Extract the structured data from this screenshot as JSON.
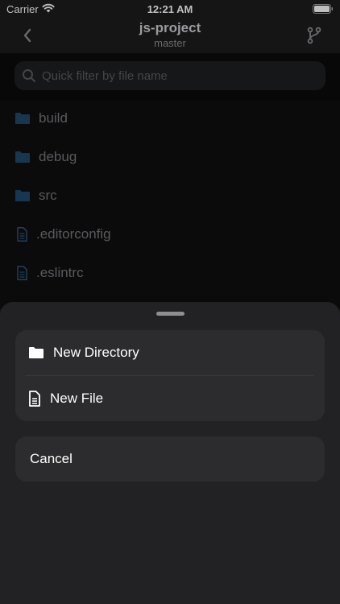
{
  "status_bar": {
    "carrier": "Carrier",
    "time": "12:21 AM",
    "wifi_icon": "wifi-icon",
    "battery_icon": "battery-full-icon"
  },
  "nav": {
    "back_icon": "chevron-left-icon",
    "title": "js-project",
    "subtitle": "master",
    "branch_icon": "git-branch-icon"
  },
  "search": {
    "placeholder": "Quick filter by file name",
    "icon": "search-icon"
  },
  "files": [
    {
      "name": "build",
      "type": "folder"
    },
    {
      "name": "debug",
      "type": "folder"
    },
    {
      "name": "src",
      "type": "folder"
    },
    {
      "name": ".editorconfig",
      "type": "file"
    },
    {
      "name": ".eslintrc",
      "type": "file"
    }
  ],
  "sheet": {
    "actions": [
      {
        "label": "New Directory",
        "icon": "folder-icon"
      },
      {
        "label": "New File",
        "icon": "document-icon"
      }
    ],
    "cancel_label": "Cancel"
  },
  "colors": {
    "folder_icon": "#1f4a6b",
    "accent_blue": "#2f6fa3",
    "sheet_background": "#222224",
    "group_background": "#2c2c2e"
  }
}
